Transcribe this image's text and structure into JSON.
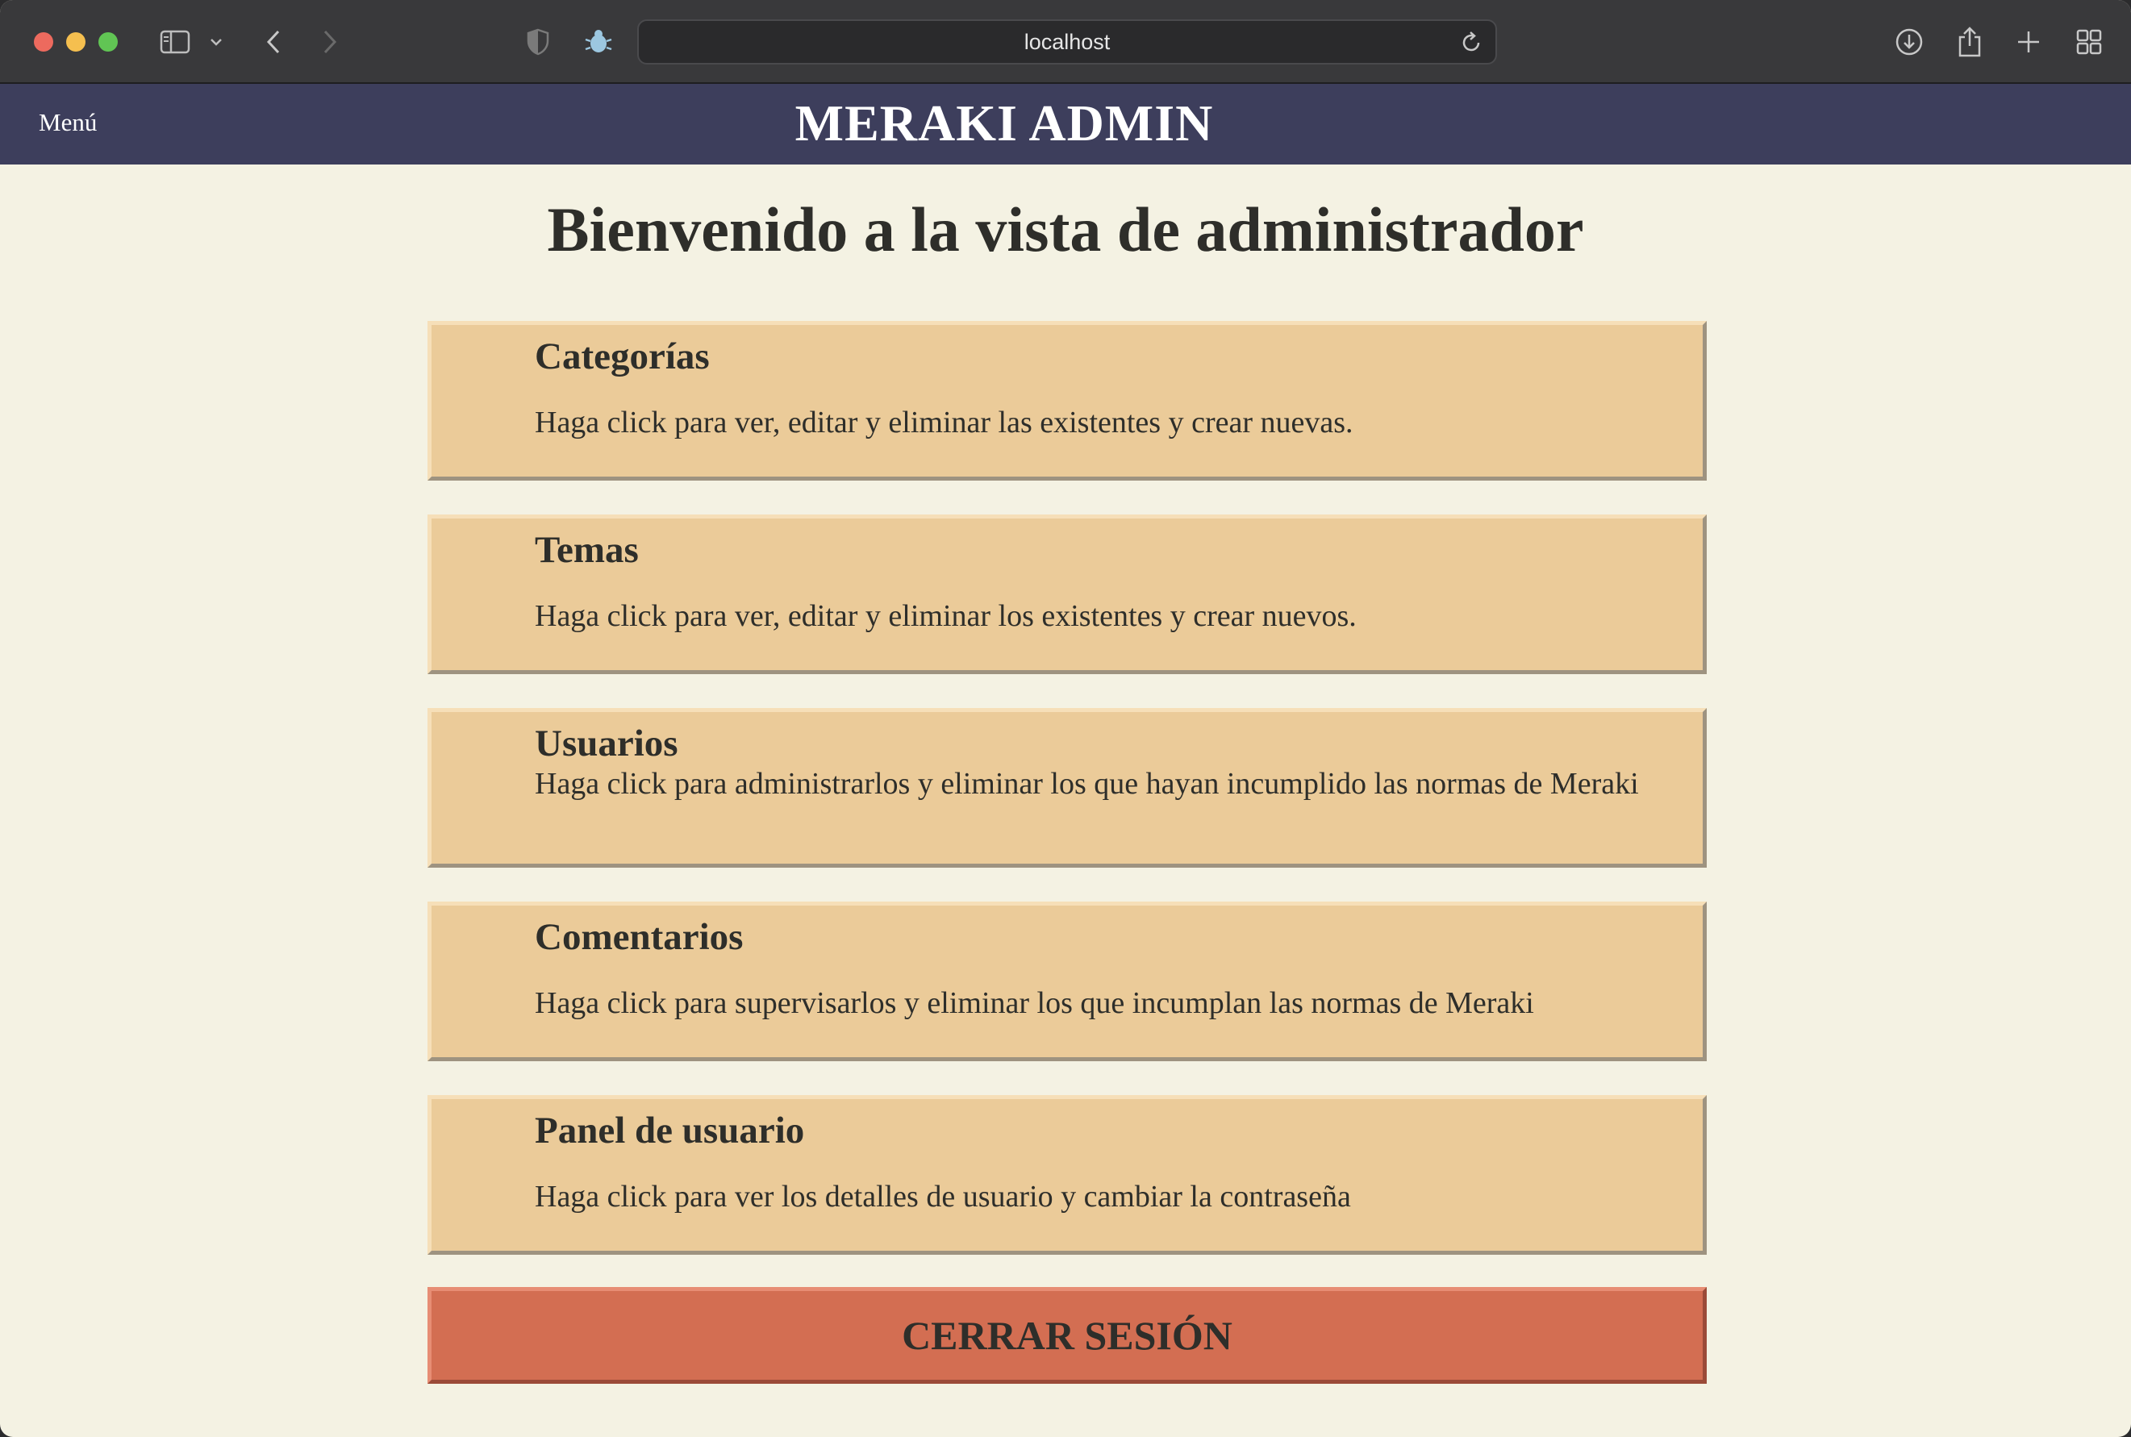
{
  "browser": {
    "url": "localhost"
  },
  "header": {
    "menu_label": "Menú",
    "brand": "MERAKI ADMIN"
  },
  "main": {
    "title": "Bienvenido a la vista de administrador",
    "cards": [
      {
        "title": "Categorías",
        "description": "Haga click para ver, editar y eliminar las existentes y crear nuevas."
      },
      {
        "title": "Temas",
        "description": "Haga click para ver, editar y eliminar los existentes y crear nuevos."
      },
      {
        "title": "Usuarios",
        "description": "Haga click para administrarlos y eliminar los que hayan incumplido las normas de Meraki"
      },
      {
        "title": "Comentarios",
        "description": "Haga click para supervisarlos y eliminar los que incumplan las normas de Meraki"
      },
      {
        "title": "Panel de usuario",
        "description": "Haga click para ver los detalles de usuario y cambiar la contraseña"
      }
    ],
    "logout_label": "CERRAR SESIÓN"
  },
  "colors": {
    "header_bg": "#3d3e5c",
    "page_bg": "#f4f2e3",
    "card_bg": "#ebcb99",
    "logout_bg": "#d36e52"
  },
  "icons": [
    "sidebar-icon",
    "chevron-down-icon",
    "back-icon",
    "forward-icon",
    "privacy-shield-icon",
    "bug-icon",
    "reload-icon",
    "download-icon",
    "share-icon",
    "new-tab-icon",
    "tab-overview-icon"
  ]
}
